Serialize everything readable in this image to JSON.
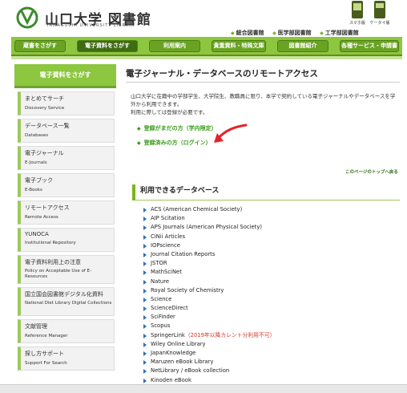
{
  "header": {
    "title": "山口大学 図書館",
    "subtitle": "YAMAGUCHI UNIVERSITY LIBRARY",
    "mobile": {
      "smartphone": "スマホ版",
      "keitai": "ケータイ版"
    },
    "sublinks": [
      "総合図書館",
      "医学部図書館",
      "工学部図書館"
    ]
  },
  "nav": {
    "items": [
      "蔵書をさがす",
      "電子資料をさがす",
      "利用案内",
      "貴重資料・特殊文庫",
      "図書館紹介",
      "各種サービス・申請書"
    ],
    "active": "電子資料をさがす"
  },
  "sidebar": {
    "heading": "電子資料をさがす",
    "items": [
      {
        "ja": "まとめてサーチ",
        "en": "Discovery Service"
      },
      {
        "ja": "データベース一覧",
        "en": "Databases"
      },
      {
        "ja": "電子ジャーナル",
        "en": "E-Journals"
      },
      {
        "ja": "電子ブック",
        "en": "E-Books"
      },
      {
        "ja": "リモートアクセス",
        "en": "Remote Access"
      },
      {
        "ja": "YUNOCA",
        "en": "Institutional Repository"
      },
      {
        "ja": "電子資料利用上の注意",
        "en": "Policy on Acceptable Use of E-Resources"
      },
      {
        "ja": "国立国会図書館デジタル化資料",
        "en": "National Diet Library Digital Collections"
      },
      {
        "ja": "文献管理",
        "en": "Reference Manager"
      },
      {
        "ja": "探し方サポート",
        "en": "Support For Search"
      }
    ]
  },
  "main": {
    "title": "電子ジャーナル・データベースのリモートアクセス",
    "intro1": "山口大学に在籍中の学部学生、大学院生、教職員に限り、本学で契約している電子ジャーナルやデータベースを学外から利用できます。",
    "intro2": "利用に際しては登録が必要です。",
    "register_new": "登録がまだの方（学内限定）",
    "register_done": "登録済みの方（ログイン）",
    "to_top": "このページのトップへ戻る",
    "db_heading": "利用できるデータベース",
    "databases": [
      {
        "name": "ACS (American Chemical Society)"
      },
      {
        "name": "AIP Scitation"
      },
      {
        "name": "APS Journals (American Physical Society)"
      },
      {
        "name": "CiNii Articles"
      },
      {
        "name": "IOPscience"
      },
      {
        "name": "Journal Citation Reports"
      },
      {
        "name": "JSTOR"
      },
      {
        "name": "MathSciNet"
      },
      {
        "name": "Nature"
      },
      {
        "name": "Royal Society of Chemistry"
      },
      {
        "name": "Science"
      },
      {
        "name": "ScienceDirect"
      },
      {
        "name": "SciFinder"
      },
      {
        "name": "Scopus"
      },
      {
        "name": "SpringerLink",
        "note": "（2019年以降カレント分利用不可）"
      },
      {
        "name": "Wiley Online Library"
      },
      {
        "name": "JapanKnowledge"
      },
      {
        "name": "Maruzen eBook Library"
      },
      {
        "name": "NetLibrary / eBook collection"
      },
      {
        "name": "Kinoden eBook"
      }
    ]
  },
  "colors": {
    "accent_green": "#8dc63f",
    "link_green": "#3a9b1c",
    "note_red": "#d03a2c",
    "annotation_red": "#e8202a"
  }
}
